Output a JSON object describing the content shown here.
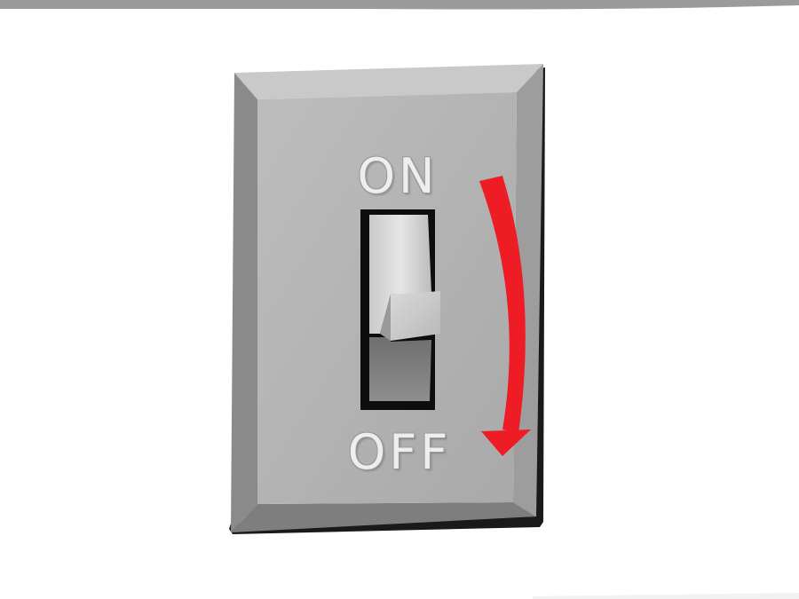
{
  "switch": {
    "on_label": "ON",
    "off_label": "OFF",
    "state": "on",
    "plate_color": "#b4b4b4",
    "arrow_color": "#ee1c24",
    "arrow_direction": "down"
  }
}
